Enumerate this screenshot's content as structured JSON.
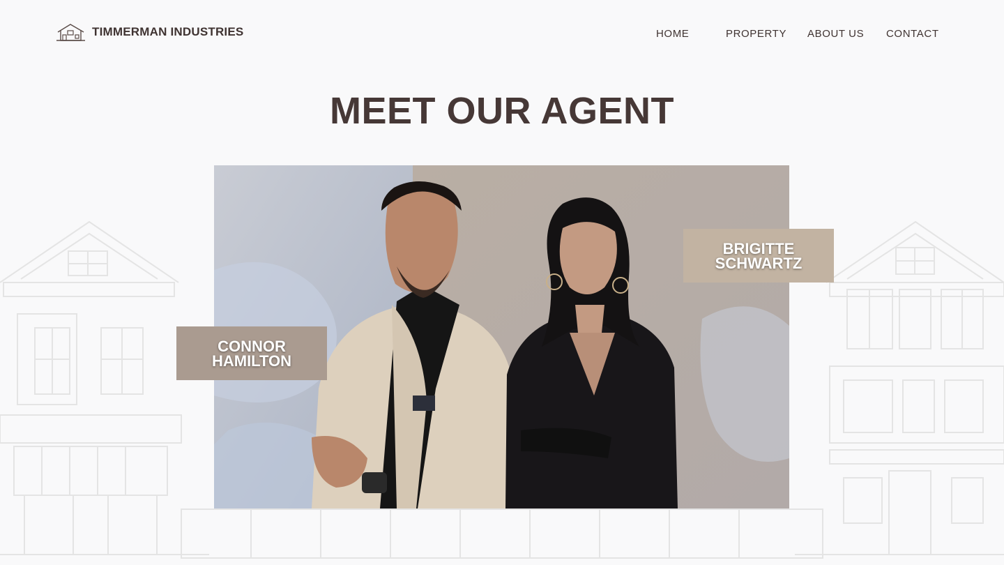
{
  "brand": {
    "name": "TIMMERMAN INDUSTRIES",
    "logo_icon": "house-outline-icon"
  },
  "nav": {
    "items": [
      {
        "label": "HOME"
      },
      {
        "label": "PROPERTY"
      },
      {
        "label": "ABOUT US"
      },
      {
        "label": "CONTACT"
      }
    ]
  },
  "main": {
    "title": "MEET OUR AGENT",
    "agents": [
      {
        "first": "CONNOR",
        "last": "HAMILTON"
      },
      {
        "first": "BRIGITTE",
        "last": "SCHWARTZ"
      }
    ]
  },
  "colors": {
    "background": "#f9f9fa",
    "text": "#3f3331",
    "card_left": "#aa9b90",
    "card_right": "#c2b3a2"
  }
}
